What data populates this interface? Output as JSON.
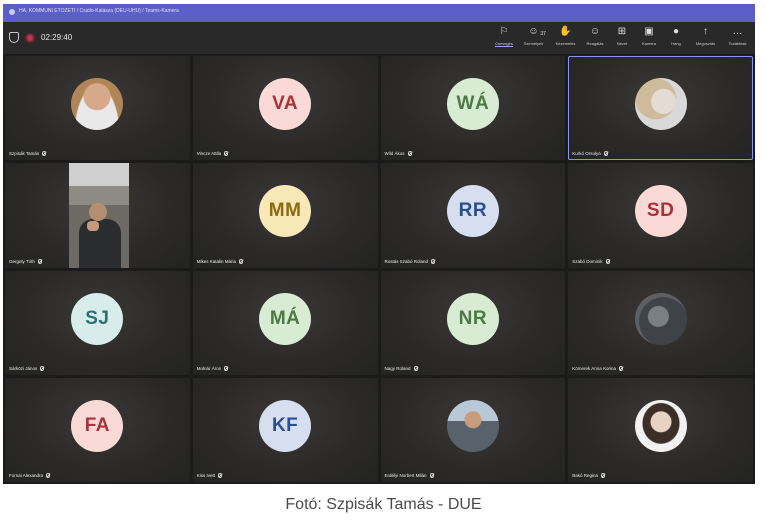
{
  "window": {
    "title": "HA, KOMMUNI ETOZETI / Csatlo-Kalásza (DEU-UHU) / Teams-Kamera",
    "timer": "02:29:40"
  },
  "toolbar": {
    "items": [
      {
        "icon": "chat-icon",
        "label": "Csevegés",
        "active": true
      },
      {
        "icon": "people-icon",
        "label": "Személyek",
        "count": "37"
      },
      {
        "icon": "raise-hand-icon",
        "label": "Kézemelés"
      },
      {
        "icon": "react-icon",
        "label": "Reagálás"
      },
      {
        "icon": "view-icon",
        "label": "Nézet"
      },
      {
        "icon": "camera-icon",
        "label": "Kamera"
      },
      {
        "icon": "mic-icon",
        "label": "Hang"
      },
      {
        "icon": "share-icon",
        "label": "Megosztás"
      },
      {
        "icon": "more-icon",
        "label": "Továbbiak"
      }
    ]
  },
  "participants": [
    {
      "name": "Szpisák Tamás",
      "avatar": "photo",
      "photo_style": "man"
    },
    {
      "name": "Vincze Attila",
      "initials": "VA",
      "color": "pink"
    },
    {
      "name": "Wild Ákos",
      "initials": "WÁ",
      "color": "green"
    },
    {
      "name": "Kurkó Orsolya",
      "avatar": "photo",
      "photo_style": "blonde",
      "selected": true
    },
    {
      "name": "Gergely Tóth",
      "avatar": "video"
    },
    {
      "name": "Mikes Katalin Mária",
      "initials": "MM",
      "color": "yellow"
    },
    {
      "name": "Rostás Szabó Roland",
      "initials": "RR",
      "color": "blue"
    },
    {
      "name": "Szabó Dominik",
      "initials": "SD",
      "color": "pink"
    },
    {
      "name": "Sárközi János",
      "initials": "SJ",
      "color": "teal"
    },
    {
      "name": "Molnár Áron",
      "initials": "MÁ",
      "color": "green"
    },
    {
      "name": "Nagy Roland",
      "initials": "NR",
      "color": "green"
    },
    {
      "name": "Kömerek Anna Korina",
      "avatar": "photo",
      "photo_style": "dark"
    },
    {
      "name": "Fornai Alexandra",
      "initials": "FA",
      "color": "pink"
    },
    {
      "name": "Kiss Ivett",
      "initials": "KF",
      "color": "blue"
    },
    {
      "name": "Erdélyi Norbert Milán",
      "avatar": "photo",
      "photo_style": "outdoor"
    },
    {
      "name": "Bakó Regina",
      "avatar": "photo",
      "photo_style": "woman"
    }
  ],
  "caption": "Fotó: Szpisák Tamás - DUE"
}
